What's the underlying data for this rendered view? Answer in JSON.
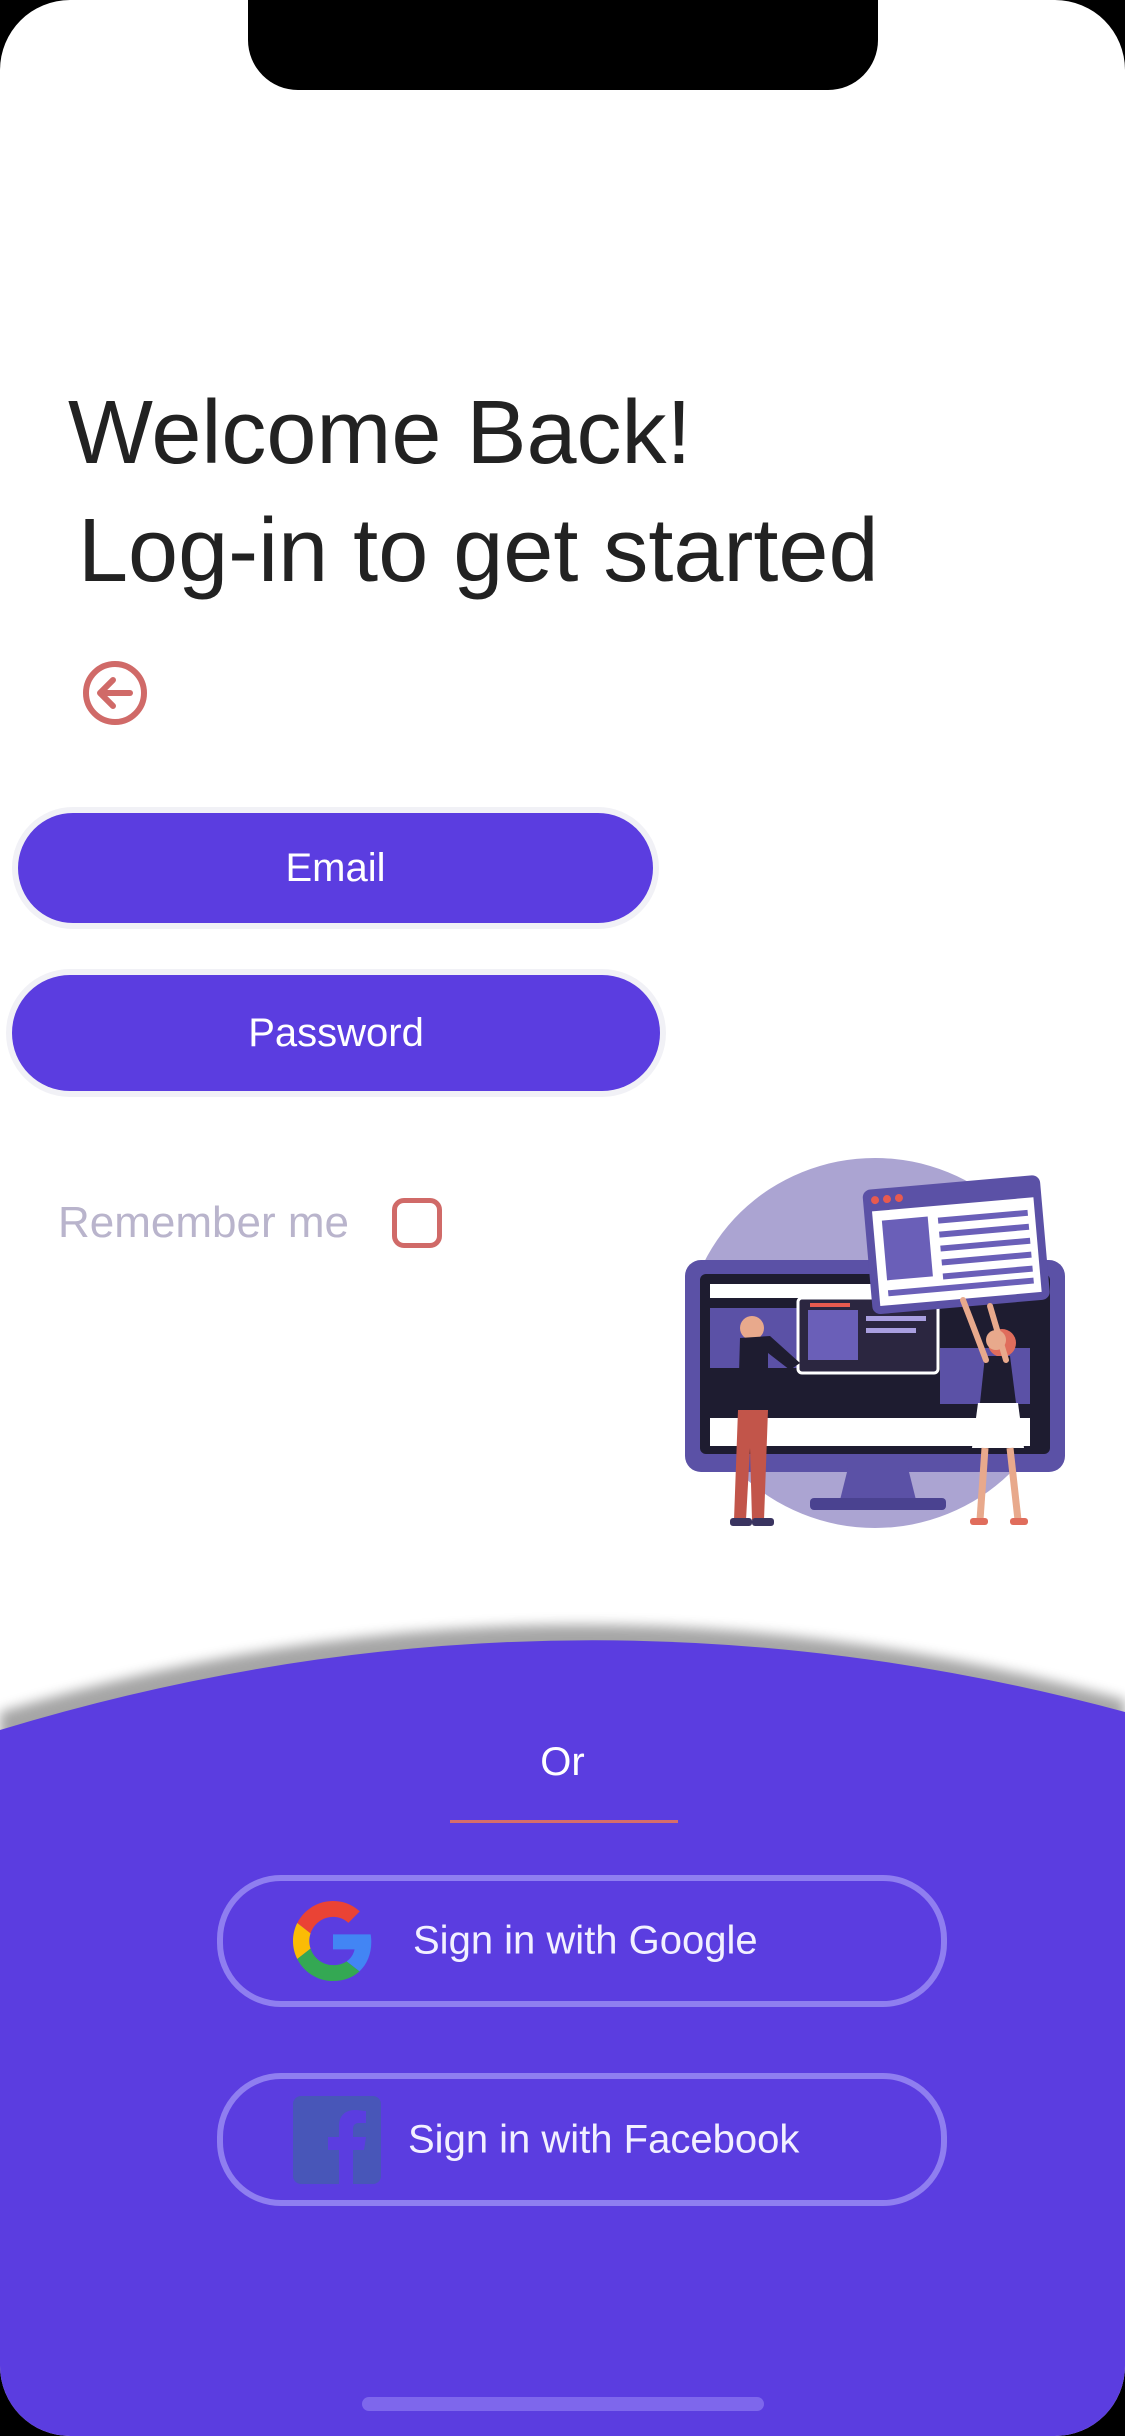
{
  "header": {
    "title_line1": "Welcome Back!",
    "title_line2": "Log-in to get started"
  },
  "icons": {
    "back": "arrow-left-circle-icon",
    "google": "google-icon",
    "facebook": "facebook-icon",
    "illustration": "web-design-team-illustration"
  },
  "form": {
    "email_label": "Email",
    "password_label": "Password",
    "remember_label": "Remember me",
    "remember_checked": false
  },
  "social": {
    "divider_text": "Or",
    "google_label": "Sign in with Google",
    "facebook_label": "Sign in with Facebook"
  },
  "colors": {
    "primary": "#5b3de0",
    "accent_red": "#d06a68",
    "panel_border": "#8f7ef0",
    "muted_text": "#b9b4cc"
  }
}
